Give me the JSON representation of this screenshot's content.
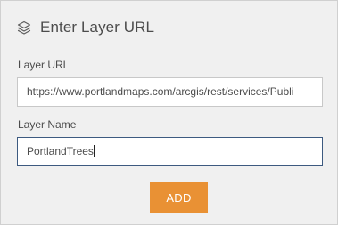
{
  "header": {
    "title": "Enter Layer URL",
    "icon": "layers-icon"
  },
  "form": {
    "url_label": "Layer URL",
    "url_value": "https://www.portlandmaps.com/arcgis/rest/services/Publi",
    "name_label": "Layer Name",
    "name_value": "PortlandTrees"
  },
  "actions": {
    "add_label": "ADD"
  },
  "colors": {
    "accent": "#e99134",
    "panel_bg": "#f0f0f0",
    "focus_border": "#3d5a80"
  }
}
